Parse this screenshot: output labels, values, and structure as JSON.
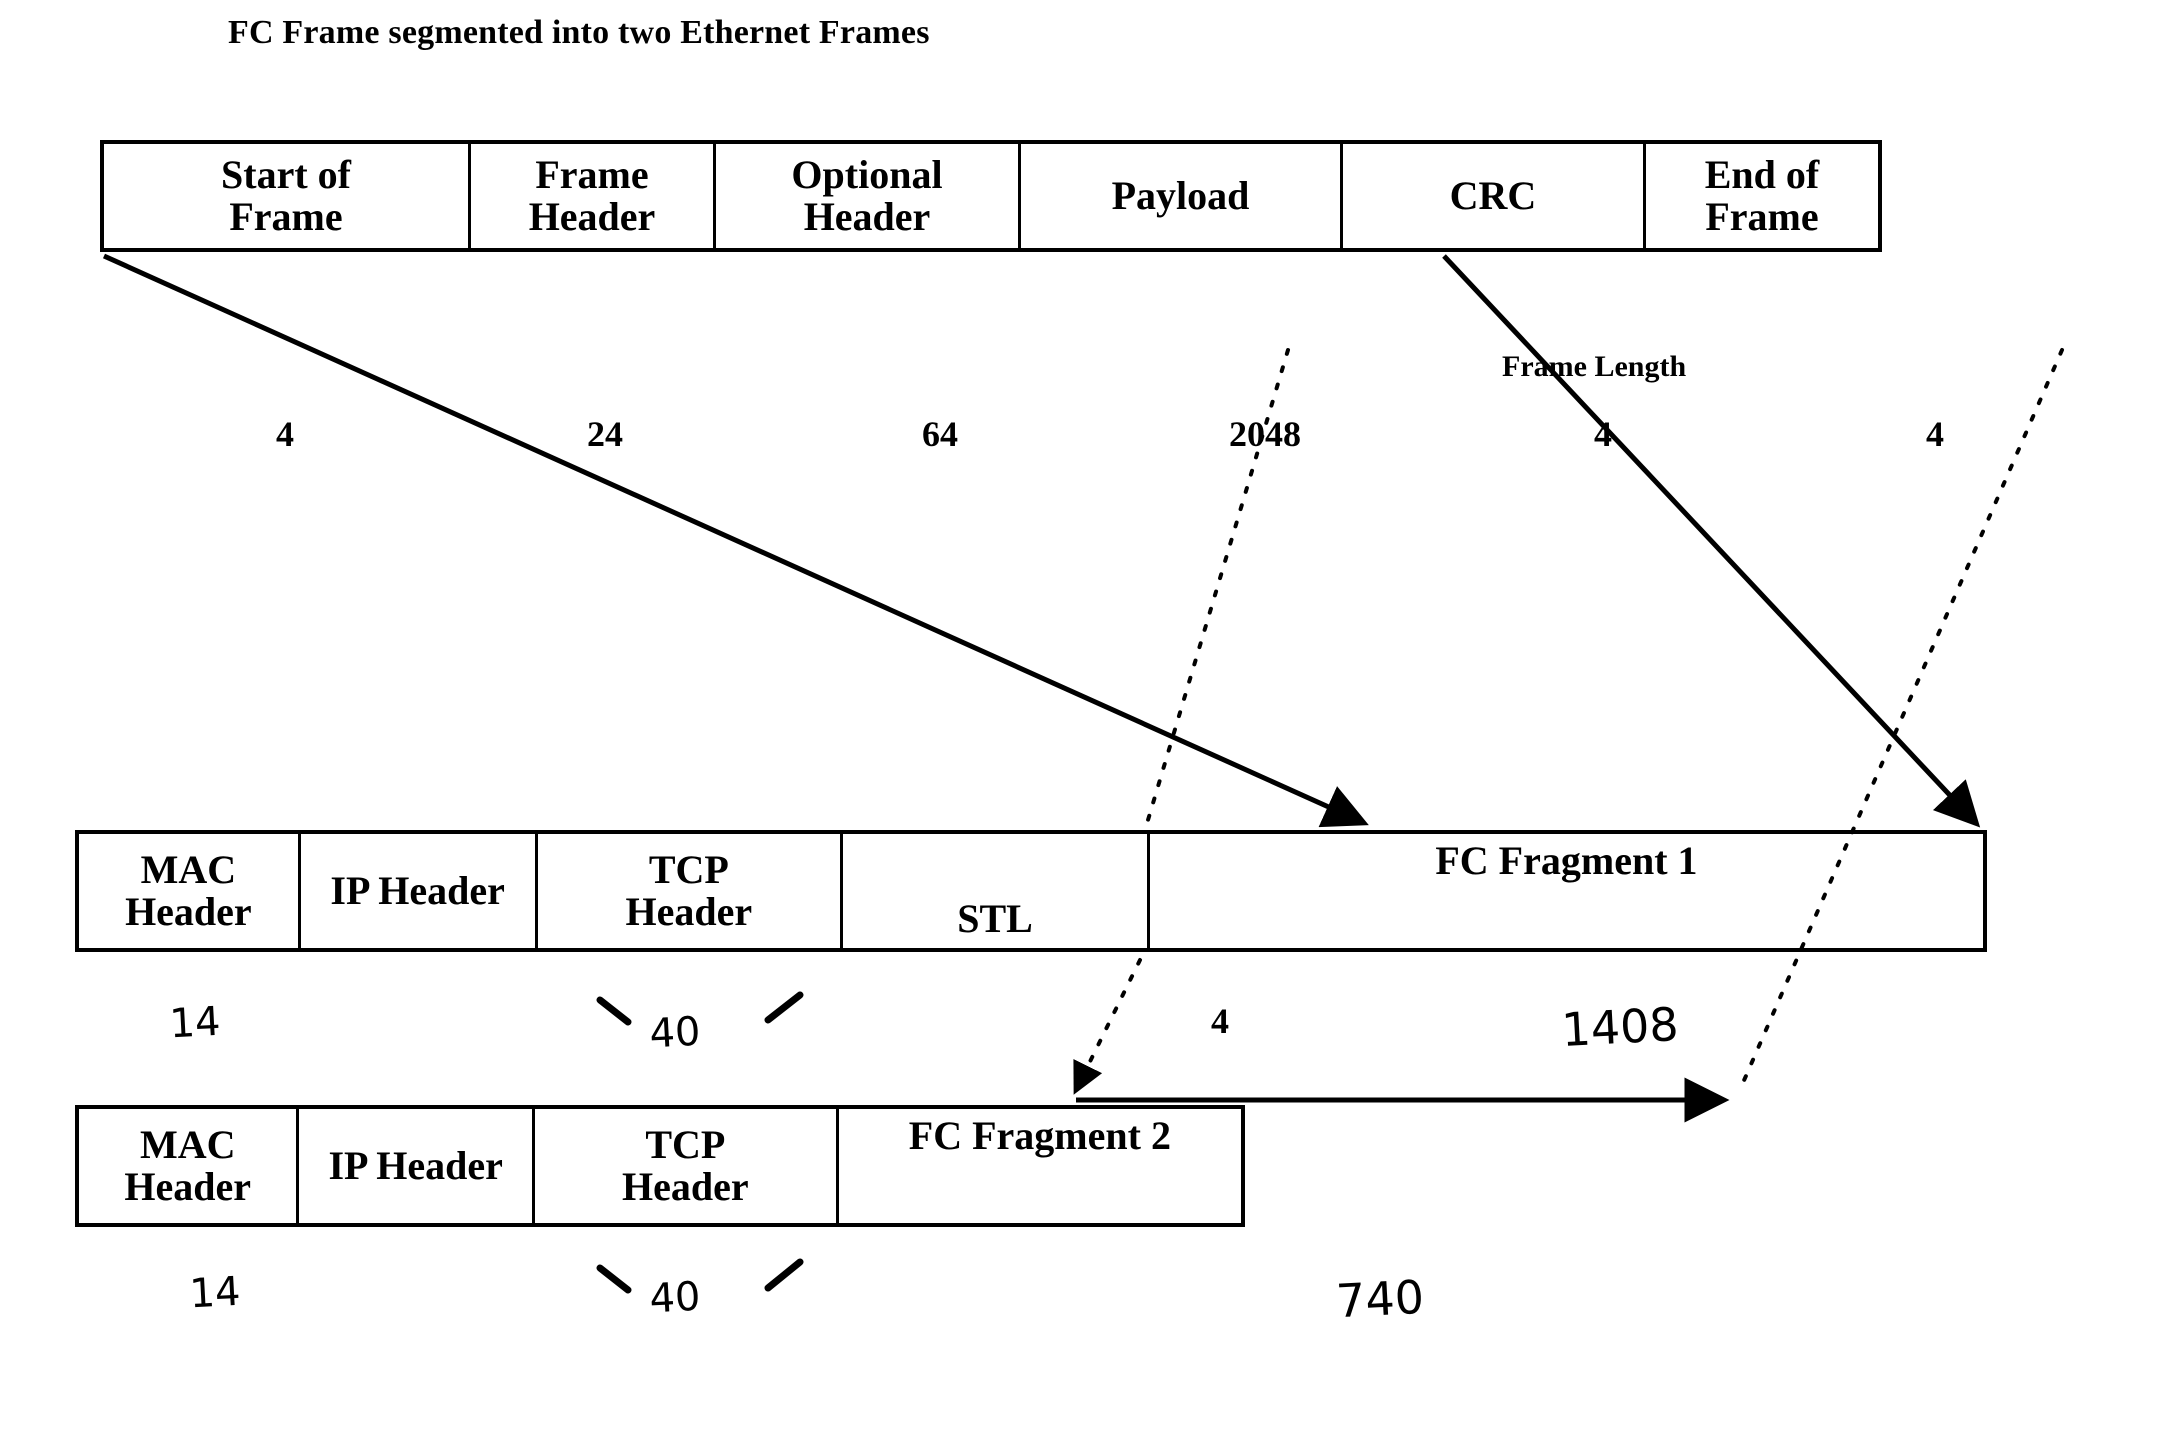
{
  "title": "FC Frame segmented into two Ethernet Frames",
  "fc_frame": {
    "name": "FC Frame",
    "cells": [
      {
        "line1": "Start of",
        "line2": "Frame",
        "size": "4"
      },
      {
        "line1": "Frame",
        "line2": "Header",
        "size": "24"
      },
      {
        "line1": "Optional",
        "line2": "Header",
        "size": "64"
      },
      {
        "line1": "Payload",
        "line2": "",
        "size": "2048"
      },
      {
        "line1": "CRC",
        "line2": "",
        "size": "4"
      },
      {
        "line1": "End of",
        "line2": "Frame",
        "size": "4"
      }
    ],
    "frame_length_label": "Frame Length"
  },
  "eth_frame_1": {
    "name": "Ethernet Frame 1",
    "cells": [
      {
        "line1": "MAC",
        "line2": "Header",
        "size": "14",
        "handwritten": true
      },
      {
        "line1": "IP Header",
        "line2": "",
        "size": "40",
        "handwritten": true
      },
      {
        "line1": "TCP",
        "line2": "Header",
        "size": "",
        "handwritten": false
      },
      {
        "line1": "STL",
        "line2": "",
        "size": "4",
        "handwritten": false
      },
      {
        "line1": "FC Fragment 1",
        "line2": "",
        "size": "1408",
        "handwritten": true
      }
    ]
  },
  "eth_frame_2": {
    "name": "Ethernet Frame 2",
    "cells": [
      {
        "line1": "MAC",
        "line2": "Header",
        "size": "14",
        "handwritten": true
      },
      {
        "line1": "IP Header",
        "line2": "",
        "size": "40",
        "handwritten": true
      },
      {
        "line1": "TCP",
        "line2": "Header",
        "size": "",
        "handwritten": false
      },
      {
        "line1": "FC Fragment 2",
        "line2": "",
        "size": "740",
        "handwritten": true
      }
    ]
  },
  "colors": {
    "ink": "#000000",
    "background": "#ffffff"
  }
}
